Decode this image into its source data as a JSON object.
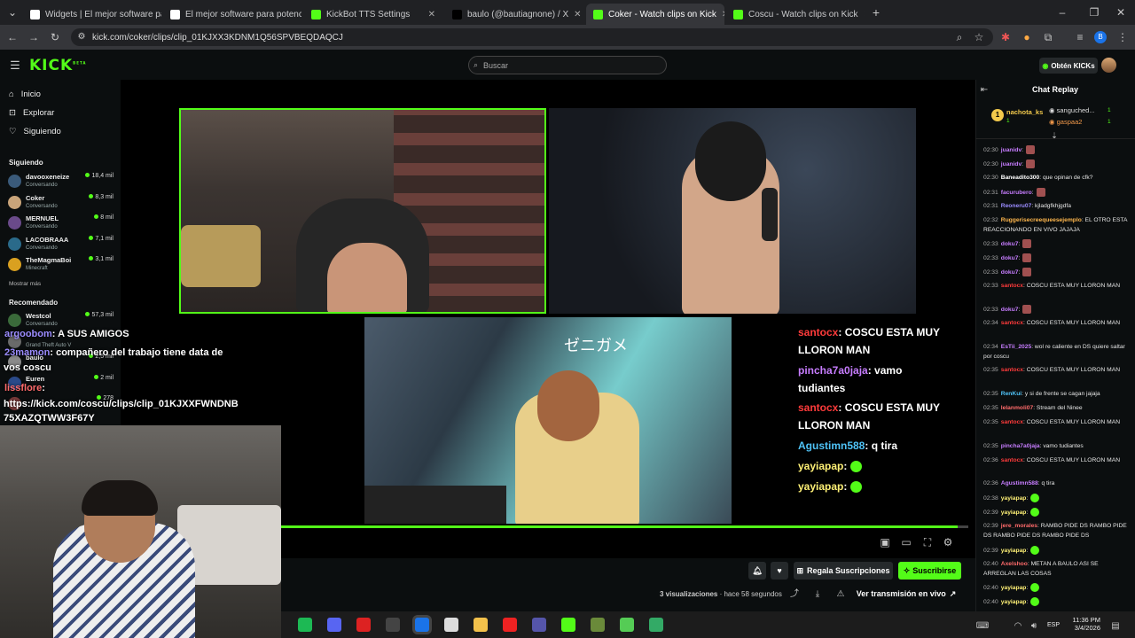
{
  "tabs": [
    {
      "label": "Widgets | El mejor software pa",
      "fav_color": "#ffffff"
    },
    {
      "label": "El mejor software para potencia",
      "fav_color": "#ffffff"
    },
    {
      "label": "KickBot TTS Settings",
      "fav_color": "#53fc18"
    },
    {
      "label": "baulo (@bautiagnone) / X",
      "fav_color": "#000000"
    },
    {
      "label": "Coker - Watch clips on Kick",
      "fav_color": "#53fc18",
      "active": true
    },
    {
      "label": "Coscu - Watch clips on Kick",
      "fav_color": "#53fc18"
    }
  ],
  "address": {
    "url": "kick.com/coker/clips/clip_01KJXX3KDNM1Q56SPVBEQDAQCJ"
  },
  "header": {
    "logo": "KICK",
    "logo_sup": "BETA",
    "search_placeholder": "Buscar",
    "kicks_button": "Obtén KICKs",
    "brand_color": "#53fc18"
  },
  "sidebar": {
    "nav": [
      {
        "label": "Inicio",
        "icon": "home-icon"
      },
      {
        "label": "Explorar",
        "icon": "compass-icon"
      },
      {
        "label": "Siguiendo",
        "icon": "heart-icon"
      }
    ],
    "following_title": "Siguiendo",
    "following": [
      {
        "name": "davooxeneize",
        "sub": "Conversando",
        "viewers": "18,4 mil"
      },
      {
        "name": "Coker",
        "sub": "Conversando",
        "viewers": "8,3 mil"
      },
      {
        "name": "MERNUEL",
        "sub": "Conversando",
        "viewers": "8 mil"
      },
      {
        "name": "LACOBRAAA",
        "sub": "Conversando",
        "viewers": "7,1 mil"
      },
      {
        "name": "TheMagmaBoi",
        "sub": "Minecraft",
        "viewers": "3,1 mil"
      }
    ],
    "show_more": "Mostrar más",
    "recommended_title": "Recomendado",
    "recommended": [
      {
        "name": "Westcol",
        "sub": "Conversando",
        "viewers": "57,3 mil"
      },
      {
        "name": "",
        "sub": "Grand Theft Auto V",
        "viewers": ""
      },
      {
        "name": "baulo",
        "sub": "",
        "viewers": "2,5 mil"
      },
      {
        "name": "Euren",
        "sub": "",
        "viewers": "2 mil"
      },
      {
        "name": "",
        "sub": "",
        "viewers": "278"
      }
    ]
  },
  "stream_overlay": {
    "left_chat": [
      {
        "user": "argoobom",
        "text": ": A SUS AMIGOS",
        "color": "#9b8cff"
      },
      {
        "user": "23mamon",
        "text": ": compañero del trabajo tiene data de",
        "color": "#9b8cff"
      },
      {
        "user": "",
        "text": "vos coscu",
        "color": "#ffffff"
      },
      {
        "user": "lissflore",
        "text": ":",
        "color": "#ff6b6b"
      },
      {
        "user": "",
        "text": "https://kick.com/coscu/clips/clip_01KJXXFWNDNB",
        "color": "#ffffff"
      },
      {
        "user": "",
        "text": "75XAZQTWW3F67Y",
        "color": "#ffffff"
      }
    ],
    "right_chat": [
      {
        "user": "santocx",
        "text": ": COSCU ESTA MUY",
        "color": "#ff3b3b"
      },
      {
        "user": "",
        "text": "LLORON MAN",
        "color": "#ffffff"
      },
      {
        "user": "pincha7a0jaja",
        "text": ": vamo",
        "color": "#c77dff"
      },
      {
        "user": "",
        "text": "tudiantes",
        "color": "#ffffff"
      },
      {
        "user": "santocx",
        "text": ": COSCU ESTA MUY",
        "color": "#ff3b3b"
      },
      {
        "user": "",
        "text": "LLORON MAN",
        "color": "#ffffff"
      },
      {
        "user": "Agustimn588",
        "text": ": q tira",
        "color": "#4fc3f7"
      },
      {
        "user": "yayiapap",
        "text": ":",
        "color": "#fff176"
      },
      {
        "user": "yayiapap",
        "text": ":",
        "color": "#fff176"
      }
    ],
    "overlay_emblem": "ゼニガメ"
  },
  "player": {
    "progress": 0.985
  },
  "below": {
    "gift_button": "Regala Suscripciones",
    "subscribe_button": "Suscribirse",
    "views_count": "3 visualizaciones",
    "time_ago": "hace 58 segundos",
    "watch_live": "Ver transmisión en vivo"
  },
  "chat": {
    "title": "Chat Replay",
    "leaders": [
      {
        "rank": "1",
        "name": "nachota_ks",
        "count": "1"
      },
      {
        "name": "sanguched...",
        "count": "1"
      },
      {
        "name": "gaspaa2",
        "count": "1"
      }
    ],
    "messages": [
      {
        "t": "02:30",
        "user": "juanidv",
        "text": ":",
        "color": "#c77dff",
        "emote": true
      },
      {
        "t": "02:30",
        "user": "juanidv",
        "text": ":",
        "color": "#c77dff",
        "emote": true
      },
      {
        "t": "02:30",
        "user": "Baneadito300",
        "text": ": que opinan de cfk?",
        "color": "#ffffff"
      },
      {
        "t": "02:31",
        "user": "facurubero",
        "text": ":",
        "color": "#c77dff",
        "emote": true
      },
      {
        "t": "02:31",
        "user": "Reoneru07",
        "text": ": kjladgfkhjgdfa",
        "color": "#9b8cff"
      },
      {
        "t": "02:32",
        "user": "Ruggerisecreequeesejemplo",
        "text": ": EL OTRO ESTA REACCIONANDO EN VIVO JAJAJA",
        "color": "#ffb74d"
      },
      {
        "t": "02:33",
        "user": "doku7",
        "text": ":",
        "color": "#c77dff",
        "emote": true
      },
      {
        "t": "02:33",
        "user": "doku7",
        "text": ":",
        "color": "#c77dff",
        "emote": true
      },
      {
        "t": "02:33",
        "user": "doku7",
        "text": ":",
        "color": "#c77dff",
        "emote": true
      },
      {
        "t": "02:33",
        "user": "santocx",
        "text": ": COSCU ESTA MUY LLORON MAN",
        "color": "#ff3b3b"
      },
      {
        "t": "02:33",
        "user": "doku7",
        "text": ":",
        "color": "#c77dff",
        "emote": true
      },
      {
        "t": "02:34",
        "user": "santocx",
        "text": ": COSCU ESTA MUY LLORON MAN",
        "color": "#ff3b3b"
      },
      {
        "t": "02:34",
        "user": "EsTii_2025",
        "text": ": wol re caliente en DS quiere saltar por coscu",
        "color": "#c77dff"
      },
      {
        "t": "02:35",
        "user": "santocx",
        "text": ": COSCU ESTA MUY LLORON MAN",
        "color": "#ff3b3b"
      },
      {
        "t": "02:35",
        "user": "RenKui",
        "text": ": y si de frente se cagan jajaja",
        "color": "#4fc3f7"
      },
      {
        "t": "02:35",
        "user": "lelanmoli07",
        "text": ": Stream del Ninee",
        "color": "#ff6b6b"
      },
      {
        "t": "02:35",
        "user": "santocx",
        "text": ": COSCU ESTA MUY LLORON MAN",
        "color": "#ff3b3b"
      },
      {
        "t": "02:35",
        "user": "pincha7a0jaja",
        "text": ": vamo tudiantes",
        "color": "#c77dff"
      },
      {
        "t": "02:36",
        "user": "santocx",
        "text": ": COSCU ESTA MUY LLORON MAN",
        "color": "#ff3b3b"
      },
      {
        "t": "02:36",
        "user": "Agustimn588",
        "text": ": q tira",
        "color": "#c77dff"
      },
      {
        "t": "02:38",
        "user": "yayiapap",
        "text": ":",
        "color": "#fff176",
        "emote": true
      },
      {
        "t": "02:39",
        "user": "yayiapap",
        "text": ":",
        "color": "#fff176",
        "emote": true
      },
      {
        "t": "02:39",
        "user": "jere_morales",
        "text": ": RAMBO PIDE DS RAMBO PIDE DS RAMBO PIDE DS RAMBO PIDE DS",
        "color": "#ff6b6b"
      },
      {
        "t": "02:39",
        "user": "yayiapap",
        "text": ":",
        "color": "#fff176",
        "emote": true
      },
      {
        "t": "02:40",
        "user": "Axelshoo",
        "text": ": METAN A BAULO ASI SE ARREGLAN LAS COSAS",
        "color": "#ff6b6b"
      },
      {
        "t": "02:40",
        "user": "yayiapap",
        "text": ":",
        "color": "#fff176",
        "emote": true
      },
      {
        "t": "02:40",
        "user": "yayiapap",
        "text": ":",
        "color": "#fff176",
        "emote": true
      }
    ]
  },
  "taskbar": {
    "lang": "ESP",
    "time": "11:36 PM",
    "date": "3/4/2026"
  }
}
